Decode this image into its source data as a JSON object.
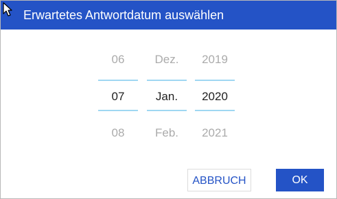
{
  "dialog": {
    "title": "Erwartetes Antwortdatum auswählen",
    "picker": {
      "day": {
        "prev": "06",
        "selected": "07",
        "next": "08"
      },
      "month": {
        "prev": "Dez.",
        "selected": "Jan.",
        "next": "Feb."
      },
      "year": {
        "prev": "2019",
        "selected": "2020",
        "next": "2021"
      }
    },
    "buttons": {
      "cancel_label": "ABBRUCH",
      "ok_label": "OK"
    }
  },
  "colors": {
    "accent": "#2453c6",
    "divider": "#9fd7f2"
  }
}
